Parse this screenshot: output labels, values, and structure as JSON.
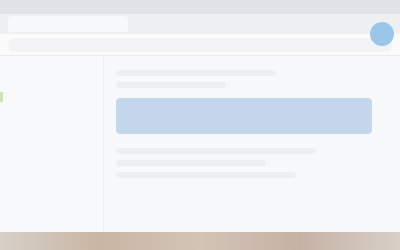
{
  "window": {
    "title": "",
    "tab_label": "",
    "address_text": ""
  },
  "sidebar": {
    "items": [
      {
        "label": ""
      },
      {
        "label": ""
      },
      {
        "label": ""
      },
      {
        "label": ""
      },
      {
        "label": ""
      }
    ]
  },
  "main": {
    "highlighted_panel_text": ""
  },
  "colors": {
    "accent": "#9cc6e8",
    "highlight_panel": "#c3d6ea",
    "taskbar": "#c9b6a4"
  }
}
